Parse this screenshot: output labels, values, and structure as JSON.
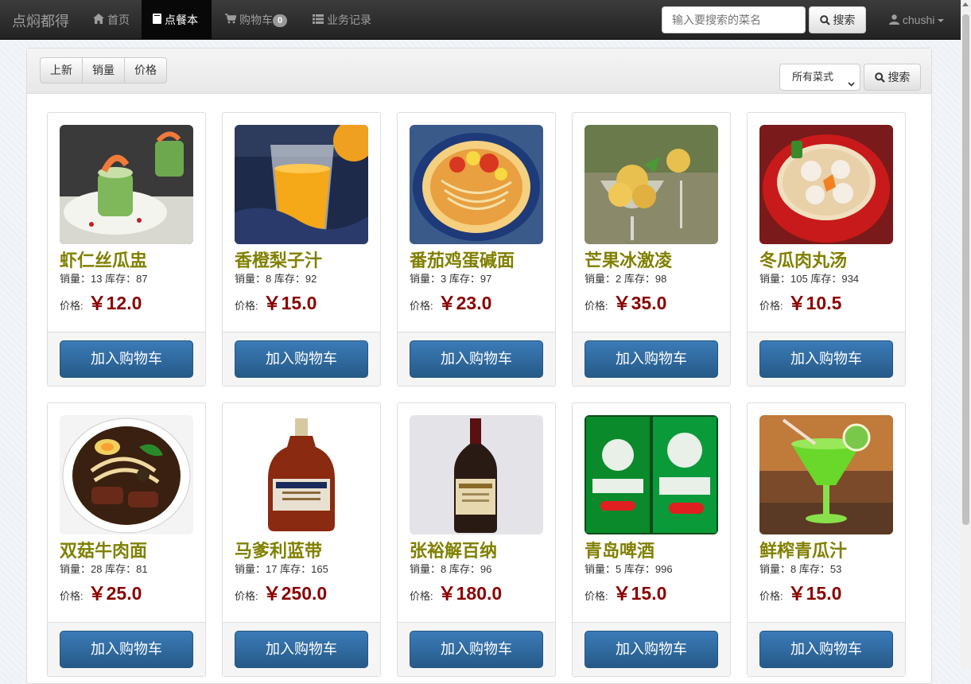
{
  "navbar": {
    "brand": "点焖都得",
    "items": [
      {
        "label": "首页",
        "icon": "home-icon"
      },
      {
        "label": "点餐本",
        "icon": "book-icon"
      },
      {
        "label": "购物车",
        "icon": "cart-icon",
        "badge": "0"
      },
      {
        "label": "业务记录",
        "icon": "list-icon"
      }
    ],
    "search_placeholder": "输入要搜索的菜名",
    "search_button": "搜索",
    "user": "chushi"
  },
  "toolbar": {
    "sort_buttons": [
      "上新",
      "销量",
      "价格"
    ],
    "category_selected": "所有菜式",
    "search_button": "搜索"
  },
  "labels": {
    "sales": "销量：",
    "stock": "库存：",
    "price": "价格:",
    "currency": "￥",
    "add_to_cart": "加入购物车"
  },
  "dishes": [
    {
      "name": "虾仁丝瓜盅",
      "sales": "13",
      "stock": "87",
      "price": "12.0",
      "image": "shrimp-cucumber-image"
    },
    {
      "name": "香橙梨子汁",
      "sales": "8",
      "stock": "92",
      "price": "15.0",
      "image": "orange-juice-image"
    },
    {
      "name": "番茄鸡蛋碱面",
      "sales": "3",
      "stock": "97",
      "price": "23.0",
      "image": "tomato-egg-noodle-image"
    },
    {
      "name": "芒果冰激凌",
      "sales": "2",
      "stock": "98",
      "price": "35.0",
      "image": "mango-icecream-image"
    },
    {
      "name": "冬瓜肉丸汤",
      "sales": "105",
      "stock": "934",
      "price": "10.5",
      "image": "meatball-soup-image"
    },
    {
      "name": "双菇牛肉面",
      "sales": "28",
      "stock": "81",
      "price": "25.0",
      "image": "beef-noodle-image"
    },
    {
      "name": "马爹利蓝带",
      "sales": "17",
      "stock": "165",
      "price": "250.0",
      "image": "martell-bottle-image"
    },
    {
      "name": "张裕解百纳",
      "sales": "8",
      "stock": "96",
      "price": "180.0",
      "image": "wine-bottle-image"
    },
    {
      "name": "青岛啤酒",
      "sales": "5",
      "stock": "996",
      "price": "15.0",
      "image": "beer-can-image"
    },
    {
      "name": "鲜榨青瓜汁",
      "sales": "8",
      "stock": "53",
      "price": "15.0",
      "image": "cucumber-juice-image"
    }
  ]
}
